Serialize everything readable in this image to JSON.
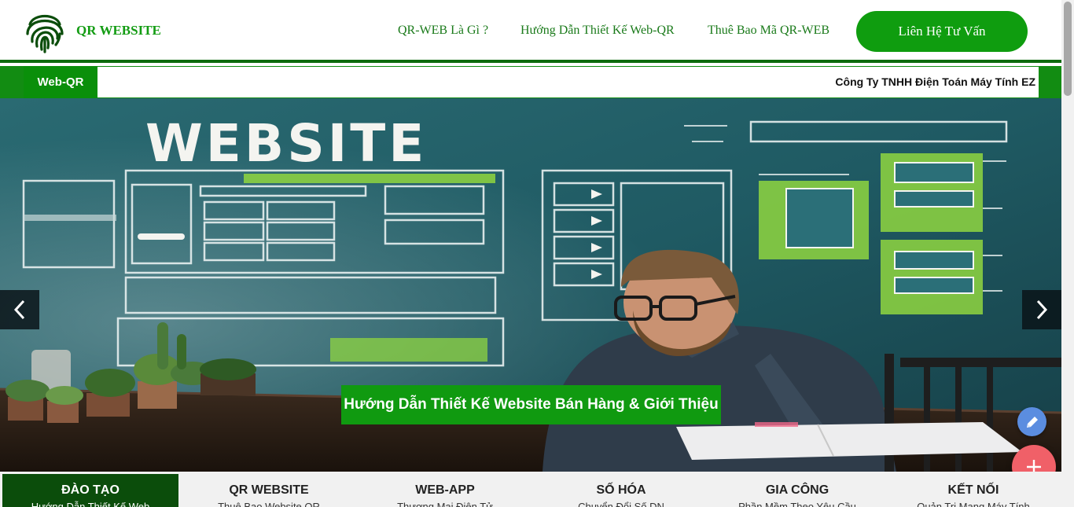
{
  "header": {
    "brand": "QR WEBSITE",
    "nav": [
      "QR-WEB Là Gì ?",
      "Hướng Dẫn Thiết Kế Web-QR",
      "Thuê Bao Mã QR-WEB"
    ],
    "cta_label": "Liên Hệ Tư Vấn"
  },
  "ticker": {
    "label": "Web-QR",
    "text": "Công Ty TNHH Điện Toán Máy Tính EZ"
  },
  "hero": {
    "board_title": "WEBSITE",
    "caption": "Hướng Dẫn Thiết Kế Website Bán Hàng & Giới Thiệu"
  },
  "tabs": [
    {
      "title": "ĐÀO TẠO",
      "subtitle": "Hướng Dẫn Thiết Kế Web",
      "active": true
    },
    {
      "title": "QR WEBSITE",
      "subtitle": "Thuê Bao Website QR",
      "active": false
    },
    {
      "title": "WEB-APP",
      "subtitle": "Thương Mại Điện Tử",
      "active": false
    },
    {
      "title": "SỐ HÓA",
      "subtitle": "Chuyển Đổi Số DN",
      "active": false
    },
    {
      "title": "GIA CÔNG",
      "subtitle": "Phần Mềm Theo Yêu Cầu",
      "active": false
    },
    {
      "title": "KẾT NỐI",
      "subtitle": "Quản Trị Mạng Máy Tính",
      "active": false
    }
  ],
  "icons": {
    "logo": "fingerprint-icon",
    "prev": "chevron-left-icon",
    "next": "chevron-right-icon",
    "edit": "pencil-icon",
    "add": "plus-icon"
  },
  "colors": {
    "brand_green": "#0f9d0f",
    "dark_green": "#0b4d0b",
    "accent_red": "#f06068",
    "accent_blue": "#5b8de0"
  }
}
